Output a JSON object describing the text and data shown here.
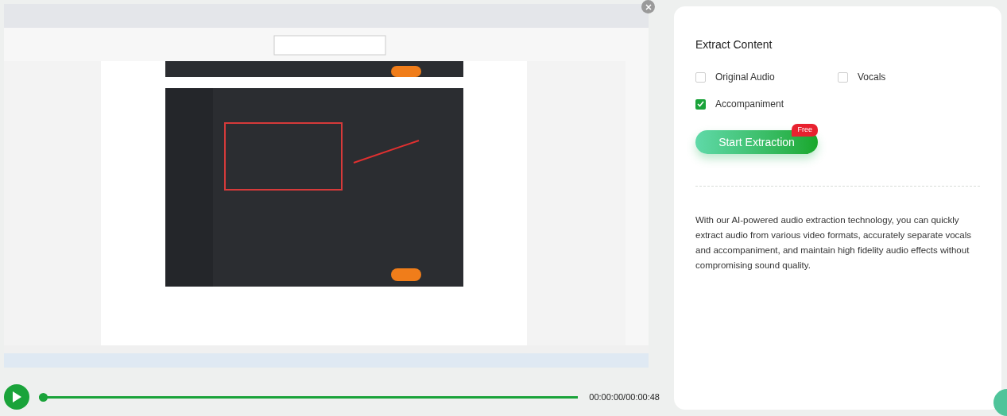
{
  "player": {
    "progress": {
      "level": 0.0
    },
    "time": "00:00:00/00:00:48"
  },
  "panel": {
    "title": "Extract Content",
    "options": [
      {
        "label": "Original Audio",
        "checked": false
      },
      {
        "label": "Vocals",
        "checked": false
      },
      {
        "label": "Accompaniment",
        "checked": true
      }
    ],
    "button": {
      "label": "Start Extraction",
      "badge": "Free"
    },
    "description": "With our AI-powered audio extraction technology, you can quickly extract audio from various video formats, accurately separate vocals and accompaniment, and maintain high fidelity audio effects without compromising sound quality."
  }
}
